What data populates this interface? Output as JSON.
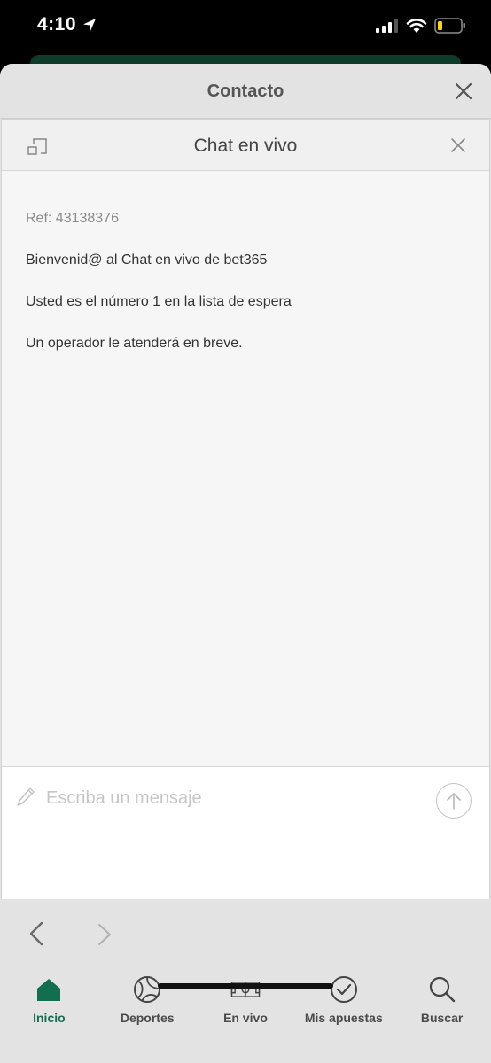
{
  "status_bar": {
    "time": "4:10"
  },
  "sheet": {
    "title": "Contacto"
  },
  "chat": {
    "title": "Chat en vivo",
    "messages": [
      "Ref: 43138376",
      "Bienvenid@ al Chat en vivo de bet365",
      "Usted es el número 1 en la lista de espera",
      "Un operador le atenderá en breve."
    ],
    "input": {
      "placeholder": "Escriba un mensaje",
      "value": ""
    }
  },
  "tabs": [
    {
      "label": "Inicio",
      "icon": "home-icon",
      "active": true
    },
    {
      "label": "Deportes",
      "icon": "soccer-ball-icon",
      "active": false
    },
    {
      "label": "En vivo",
      "icon": "pitch-icon",
      "active": false
    },
    {
      "label": "Mis apuestas",
      "icon": "check-circle-icon",
      "active": false
    },
    {
      "label": "Buscar",
      "icon": "search-icon",
      "active": false
    }
  ],
  "colors": {
    "accent": "#126e51",
    "sheet_bg": "#e3e3e3",
    "chat_bg": "#f6f6f6",
    "battery_fill": "#ffd60a"
  }
}
